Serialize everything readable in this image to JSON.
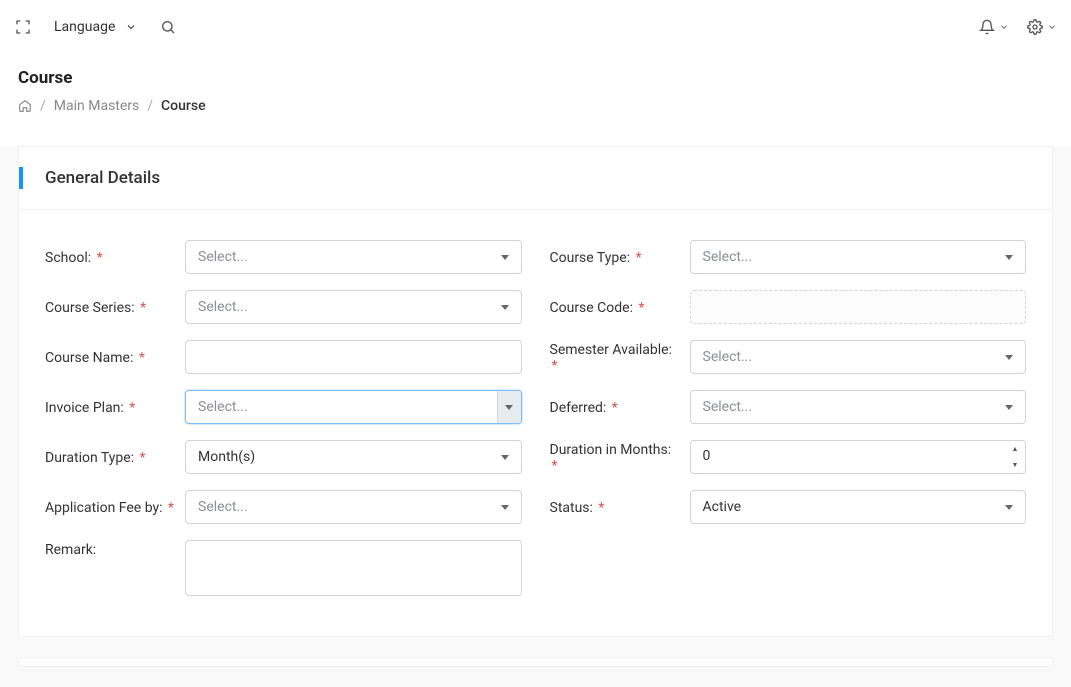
{
  "topbar": {
    "language_label": "Language"
  },
  "header": {
    "title": "Course",
    "breadcrumb": {
      "item1": "Main Masters",
      "current": "Course"
    }
  },
  "card": {
    "title": "General Details"
  },
  "form": {
    "school": {
      "label": "School:",
      "placeholder": "Select..."
    },
    "course_type": {
      "label": "Course Type:",
      "placeholder": "Select..."
    },
    "course_series": {
      "label": "Course Series:",
      "placeholder": "Select..."
    },
    "course_code": {
      "label": "Course Code:",
      "value": ""
    },
    "course_name": {
      "label": "Course Name:",
      "value": ""
    },
    "semester_available": {
      "label": "Semester Available:",
      "placeholder": "Select..."
    },
    "invoice_plan": {
      "label": "Invoice Plan:",
      "placeholder": "Select..."
    },
    "deferred": {
      "label": "Deferred:",
      "placeholder": "Select..."
    },
    "duration_type": {
      "label": "Duration Type:",
      "value": "Month(s)"
    },
    "duration_months": {
      "label": "Duration in Months:",
      "value": "0"
    },
    "application_fee_by": {
      "label": "Application Fee by:",
      "placeholder": "Select..."
    },
    "status": {
      "label": "Status:",
      "value": "Active"
    },
    "remark": {
      "label": "Remark:",
      "value": ""
    },
    "required_marker": "*"
  }
}
